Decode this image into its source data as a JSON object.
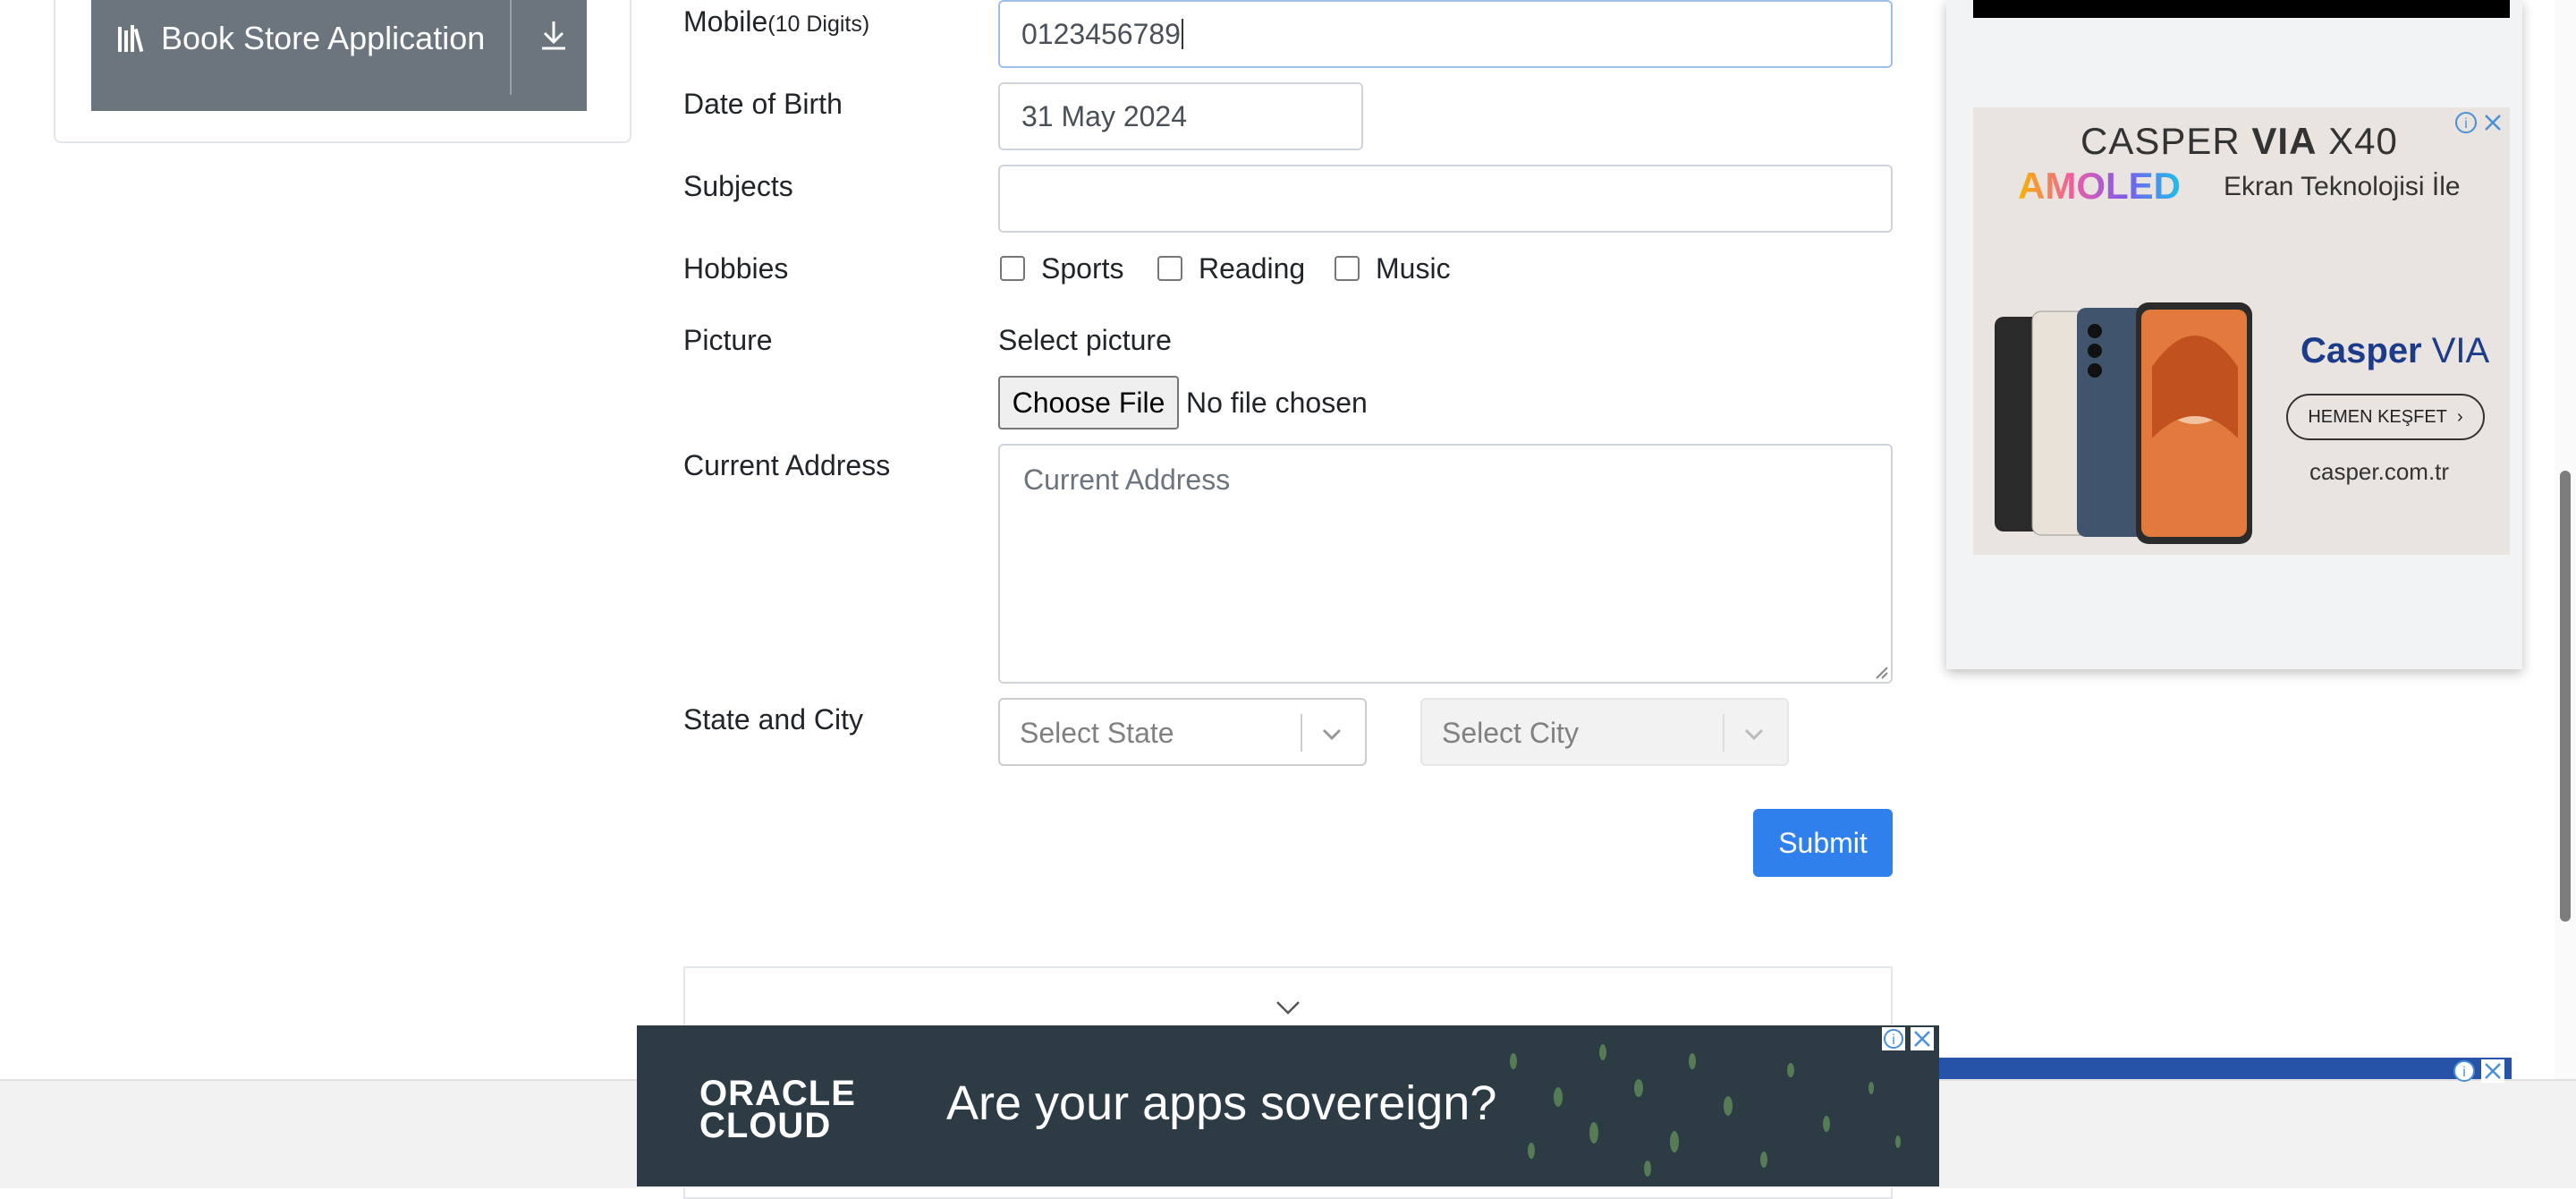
{
  "sidebar": {
    "book_store_label": "Book Store Application",
    "book_icon": "books-icon",
    "download_icon": "download-icon"
  },
  "form": {
    "mobile_label": "Mobile",
    "mobile_hint": "(10 Digits)",
    "mobile_value": "0123456789",
    "dob_label": "Date of Birth",
    "dob_value": "31 May 2024",
    "subjects_label": "Subjects",
    "subjects_value": "",
    "hobbies_label": "Hobbies",
    "hobbies": [
      {
        "label": "Sports",
        "checked": false
      },
      {
        "label": "Reading",
        "checked": false
      },
      {
        "label": "Music",
        "checked": false
      }
    ],
    "picture_label": "Picture",
    "select_picture": "Select picture",
    "choose_file": "Choose File",
    "no_file": "No file chosen",
    "address_label": "Current Address",
    "address_placeholder": "Current Address",
    "state_city_label": "State and City",
    "state_placeholder": "Select State",
    "city_placeholder": "Select City",
    "submit_label": "Submit"
  },
  "right_ad": {
    "title_a": "CASPER",
    "title_b": "VIA",
    "title_c": "X40",
    "amoled": "AMOLED",
    "ekran": "Ekran Teknolojisi İle",
    "brand_a": "Casper",
    "brand_b": "VIA",
    "cta": "HEMEN KEŞFET",
    "domain": "casper.com.tr"
  },
  "bottom_ad": {
    "logo_line1": "ORACLE",
    "logo_line2": "CLOUD",
    "headline": "Are your apps sovereign?"
  },
  "colors": {
    "primary": "#2f80ed",
    "secondary": "#6c757d",
    "oracle_bg": "#2d3b45",
    "casper_brand": "#1d3b8b"
  }
}
